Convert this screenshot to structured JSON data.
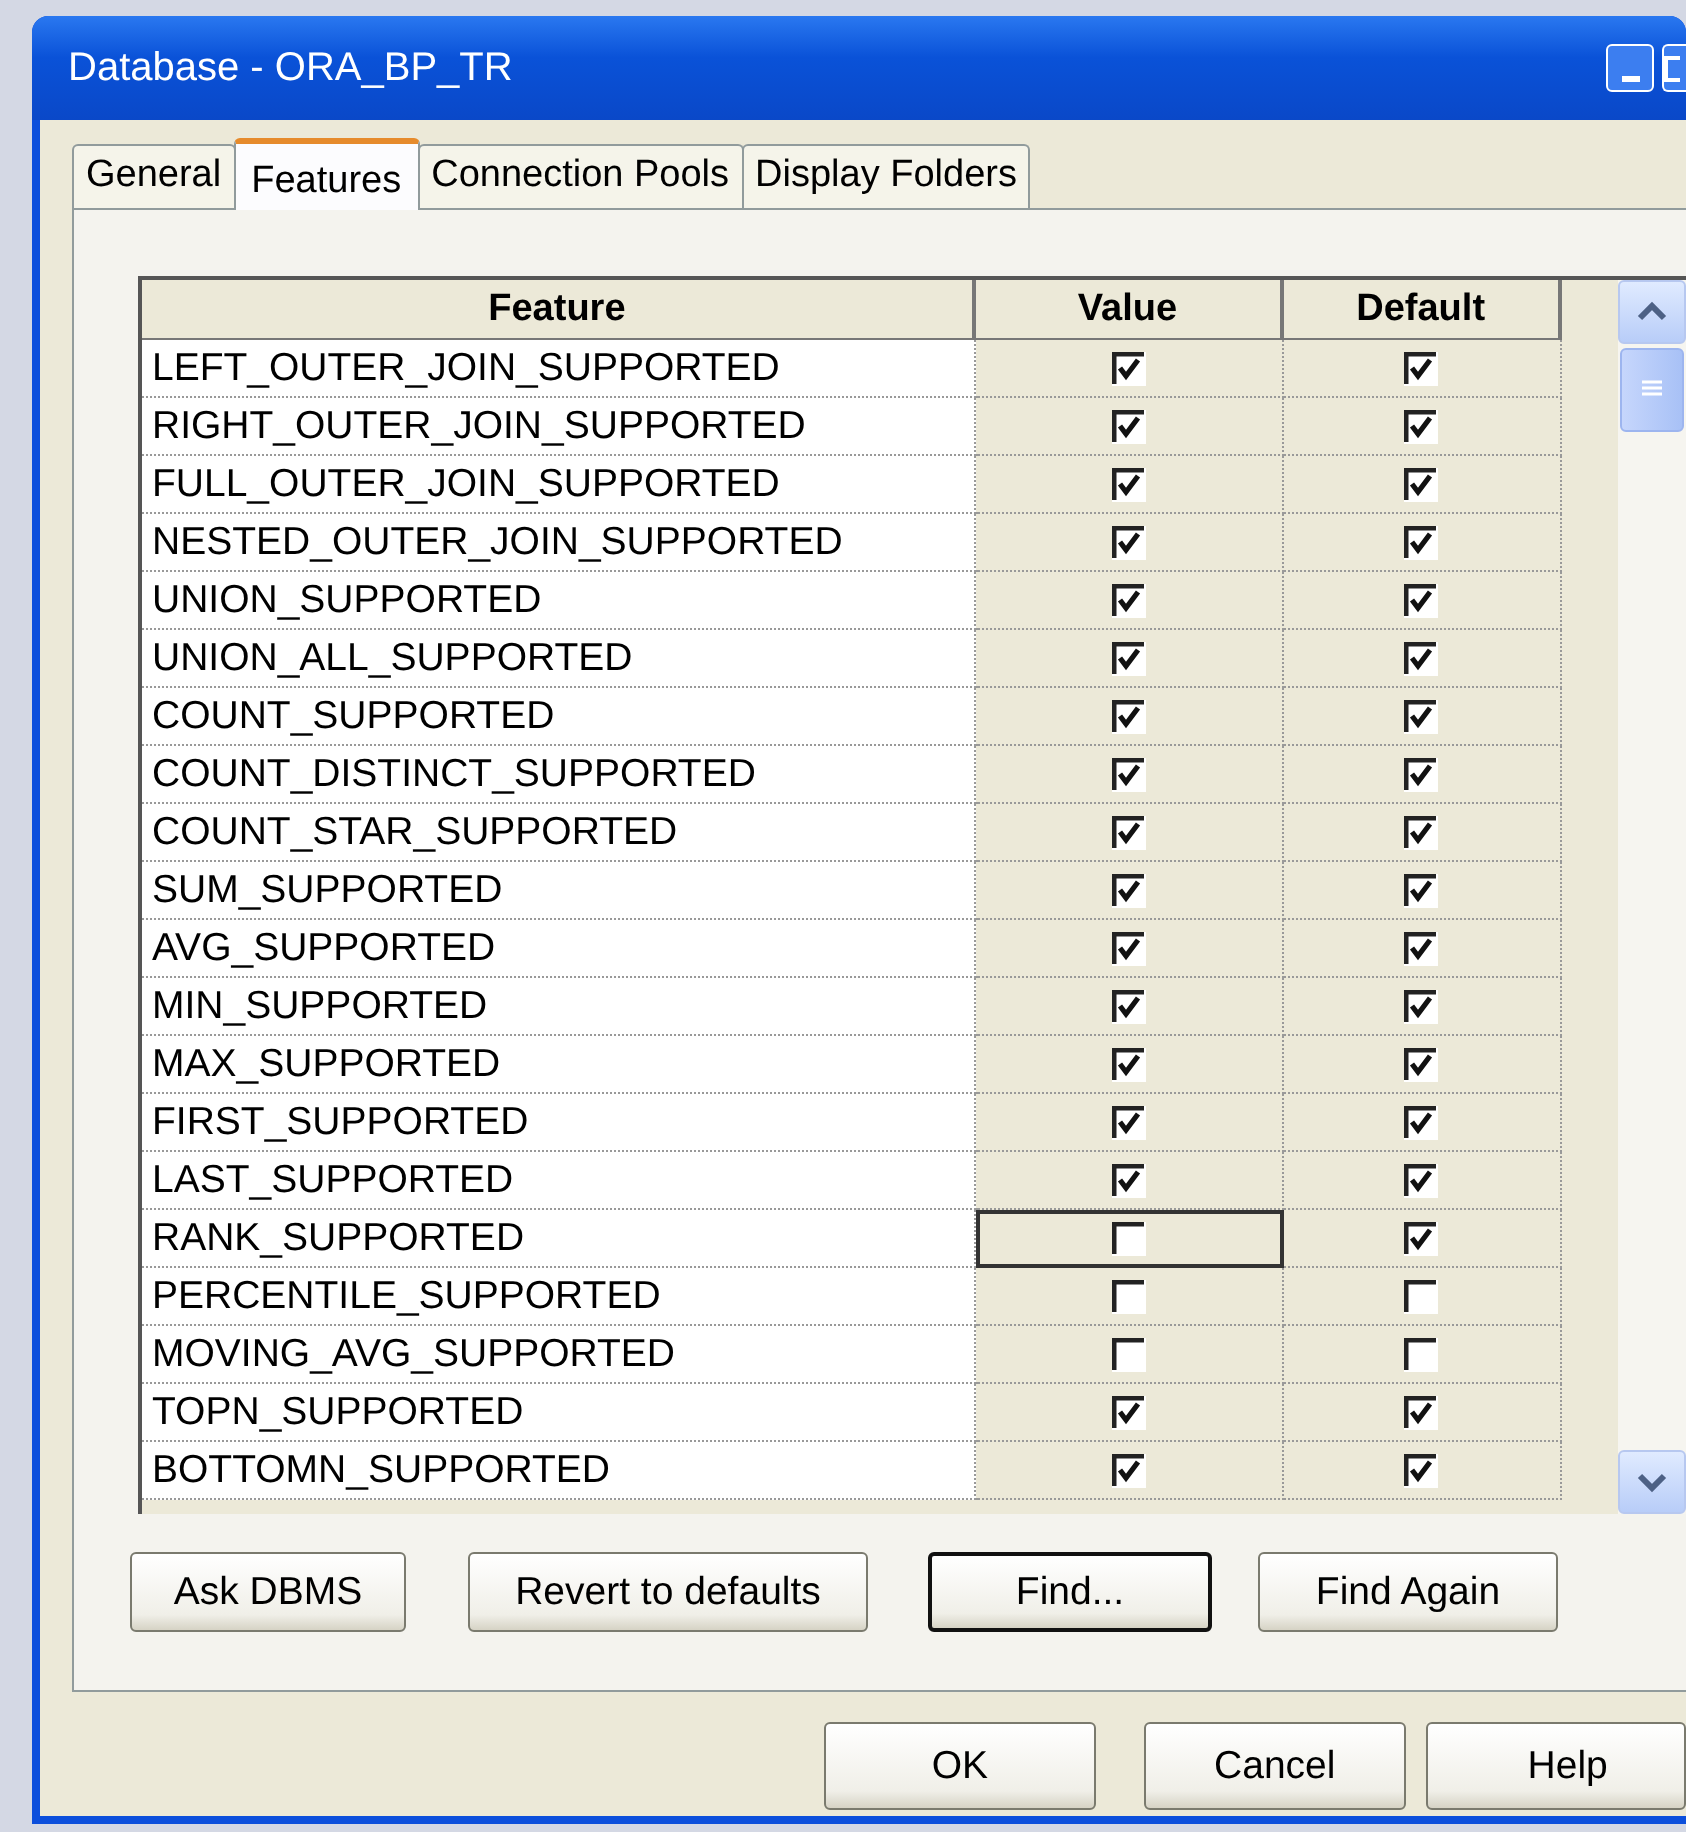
{
  "window": {
    "title": "Database - ORA_BP_TR"
  },
  "tabs": [
    {
      "label": "General",
      "selected": false
    },
    {
      "label": "Features",
      "selected": true
    },
    {
      "label": "Connection Pools",
      "selected": false
    },
    {
      "label": "Display Folders",
      "selected": false
    }
  ],
  "table": {
    "columns": [
      "Feature",
      "Value",
      "Default"
    ],
    "rows": [
      {
        "feature": "LEFT_OUTER_JOIN_SUPPORTED",
        "value": true,
        "default": true,
        "focused": false
      },
      {
        "feature": "RIGHT_OUTER_JOIN_SUPPORTED",
        "value": true,
        "default": true,
        "focused": false
      },
      {
        "feature": "FULL_OUTER_JOIN_SUPPORTED",
        "value": true,
        "default": true,
        "focused": false
      },
      {
        "feature": "NESTED_OUTER_JOIN_SUPPORTED",
        "value": true,
        "default": true,
        "focused": false
      },
      {
        "feature": "UNION_SUPPORTED",
        "value": true,
        "default": true,
        "focused": false
      },
      {
        "feature": "UNION_ALL_SUPPORTED",
        "value": true,
        "default": true,
        "focused": false
      },
      {
        "feature": "COUNT_SUPPORTED",
        "value": true,
        "default": true,
        "focused": false
      },
      {
        "feature": "COUNT_DISTINCT_SUPPORTED",
        "value": true,
        "default": true,
        "focused": false
      },
      {
        "feature": "COUNT_STAR_SUPPORTED",
        "value": true,
        "default": true,
        "focused": false
      },
      {
        "feature": "SUM_SUPPORTED",
        "value": true,
        "default": true,
        "focused": false
      },
      {
        "feature": "AVG_SUPPORTED",
        "value": true,
        "default": true,
        "focused": false
      },
      {
        "feature": "MIN_SUPPORTED",
        "value": true,
        "default": true,
        "focused": false
      },
      {
        "feature": "MAX_SUPPORTED",
        "value": true,
        "default": true,
        "focused": false
      },
      {
        "feature": "FIRST_SUPPORTED",
        "value": true,
        "default": true,
        "focused": false
      },
      {
        "feature": "LAST_SUPPORTED",
        "value": true,
        "default": true,
        "focused": false
      },
      {
        "feature": "RANK_SUPPORTED",
        "value": false,
        "default": true,
        "focused": true
      },
      {
        "feature": "PERCENTILE_SUPPORTED",
        "value": false,
        "default": false,
        "focused": false
      },
      {
        "feature": "MOVING_AVG_SUPPORTED",
        "value": false,
        "default": false,
        "focused": false
      },
      {
        "feature": "TOPN_SUPPORTED",
        "value": true,
        "default": true,
        "focused": false
      },
      {
        "feature": "BOTTOMN_SUPPORTED",
        "value": true,
        "default": true,
        "focused": false
      }
    ]
  },
  "panel_buttons": [
    {
      "label": "Ask DBMS",
      "default": false
    },
    {
      "label": "Revert to defaults",
      "default": false
    },
    {
      "label": "Find...",
      "default": true
    },
    {
      "label": "Find Again",
      "default": false
    }
  ],
  "dialog_buttons": [
    "OK",
    "Cancel",
    "Help"
  ]
}
